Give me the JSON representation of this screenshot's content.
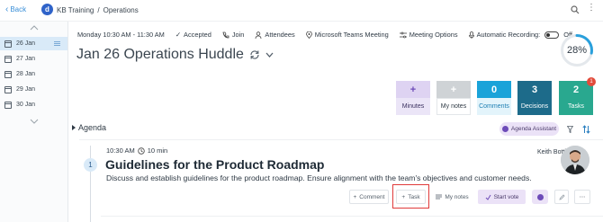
{
  "header": {
    "back_label": "Back",
    "org_initial": "d",
    "breadcrumb": [
      "KB Training",
      "/",
      "Operations"
    ]
  },
  "sidebar": {
    "items": [
      {
        "label": "26 Jan",
        "active": true
      },
      {
        "label": "27 Jan",
        "active": false
      },
      {
        "label": "28 Jan",
        "active": false
      },
      {
        "label": "29 Jan",
        "active": false
      },
      {
        "label": "30 Jan",
        "active": false
      }
    ]
  },
  "meeting": {
    "time": "Monday  10:30 AM - 11:30 AM",
    "status": "Accepted",
    "join": "Join",
    "attendees": "Attendees",
    "location": "Microsoft Teams Meeting",
    "options": "Meeting Options",
    "recording_label": "Automatic Recording:",
    "recording_state": "Off",
    "title": "Jan 26 Operations Huddle",
    "progress_text": "28%",
    "progress_value": 0.28
  },
  "tiles": [
    {
      "count": "+",
      "label": "Minutes",
      "top_color": "#ded3f2",
      "bot_color": "#ebe5f7",
      "count_color": "#6d4bb8",
      "label_color": "#3b3160",
      "badge": ""
    },
    {
      "count": "+",
      "label": "My notes",
      "top_color": "#cfd3d6",
      "bot_color": "#ffffff",
      "count_color": "#ffffff",
      "label_color": "#2f3a45",
      "badge": ""
    },
    {
      "count": "0",
      "label": "Comments",
      "top_color": "#1aa3d9",
      "bot_color": "#e3f4fb",
      "count_color": "#ffffff",
      "label_color": "#1e7fb3",
      "badge": ""
    },
    {
      "count": "3",
      "label": "Decisions",
      "top_color": "#1d6b8a",
      "bot_color": "#1d6b8a",
      "count_color": "#ffffff",
      "label_color": "#ffffff",
      "badge": ""
    },
    {
      "count": "2",
      "label": "Tasks",
      "top_color": "#29a88f",
      "bot_color": "#29a88f",
      "count_color": "#ffffff",
      "label_color": "#ffffff",
      "badge": "1"
    }
  ],
  "agenda": {
    "heading": "Agenda",
    "assistant_label": "Agenda Assistant",
    "item": {
      "number": "1",
      "time": "10:30 AM",
      "duration": "10 min",
      "title": "Guidelines for the Product Roadmap",
      "description": "Discuss and establish guidelines for the product roadmap. Ensure alignment with the team's objectives and customer needs.",
      "presenter": "Keith Botti"
    },
    "actions": {
      "comment": "Comment",
      "task": "Task",
      "notes": "My notes",
      "vote": "Start vote",
      "more": "⋯"
    }
  }
}
